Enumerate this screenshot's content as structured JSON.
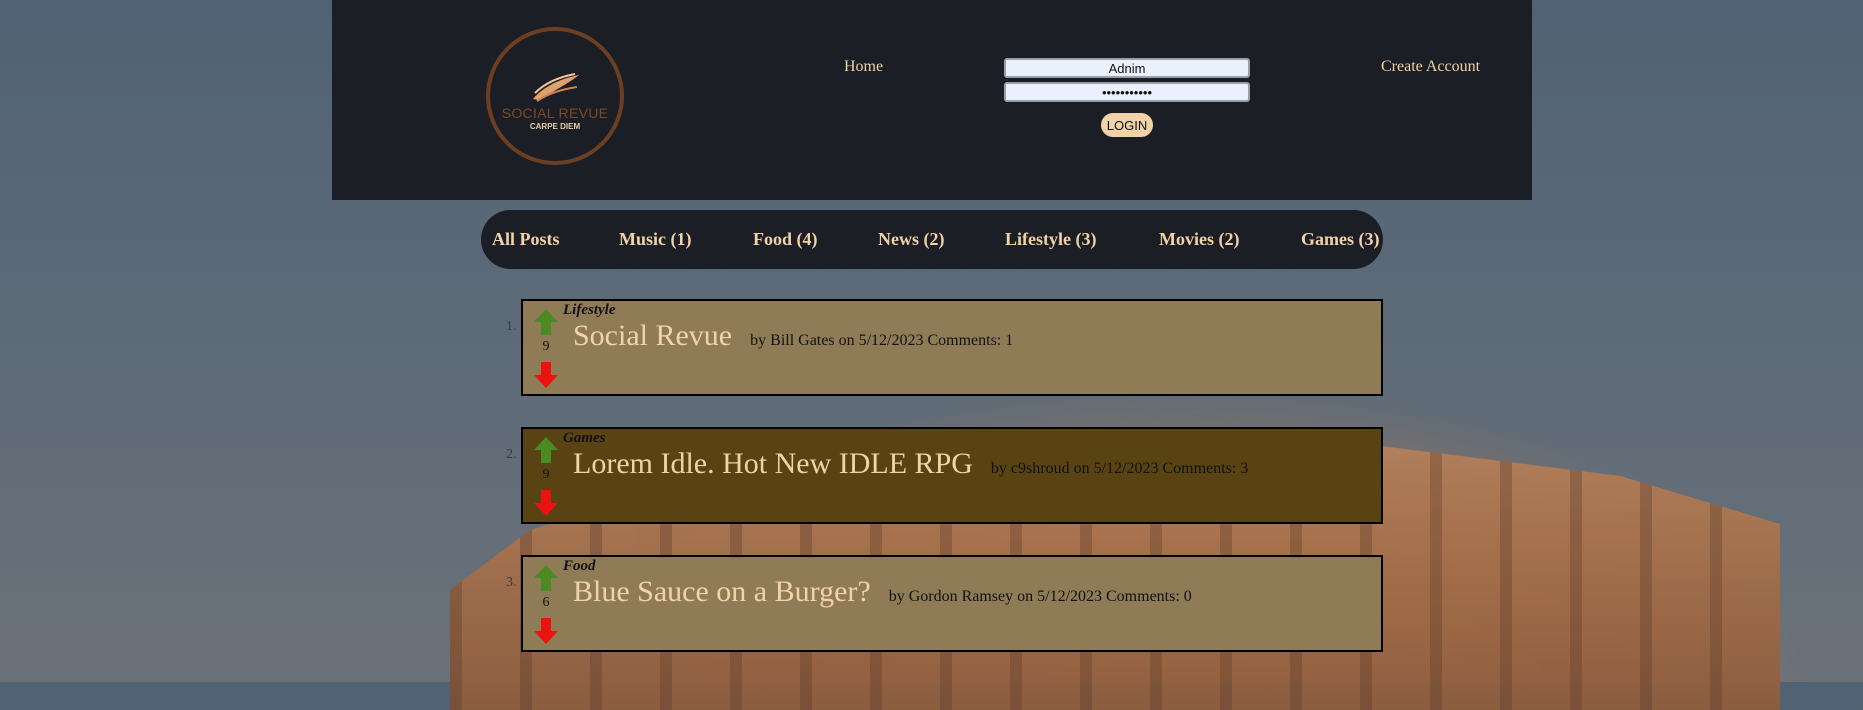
{
  "header": {
    "logo": {
      "name": "SOCIAL REVUE",
      "tagline": "CARPE DIEM"
    },
    "nav": {
      "home": "Home",
      "create_account": "Create Account"
    },
    "login": {
      "username_value": "Adnim",
      "password_value": "•••••••••••",
      "button": "LOGIN"
    }
  },
  "categories": [
    {
      "label": "All Posts"
    },
    {
      "label": "Music (1)"
    },
    {
      "label": "Food (4)"
    },
    {
      "label": "News (2)"
    },
    {
      "label": "Lifestyle (3)"
    },
    {
      "label": "Movies (2)"
    },
    {
      "label": "Games (3)"
    }
  ],
  "posts": [
    {
      "rank": "1.",
      "score": "9",
      "category": "Lifestyle",
      "title": "Social Revue",
      "meta": "by Bill Gates on 5/12/2023 Comments: 1"
    },
    {
      "rank": "2.",
      "score": "9",
      "category": "Games",
      "title": "Lorem Idle. Hot New IDLE RPG",
      "meta": "by c9shroud on 5/12/2023 Comments: 3"
    },
    {
      "rank": "3.",
      "score": "6",
      "category": "Food",
      "title": "Blue Sauce on a Burger?",
      "meta": "by Gordon Ramsey on 5/12/2023 Comments: 0"
    }
  ],
  "colors": {
    "header_bg": "#1b1e24",
    "accent": "#f2d2a7",
    "post_light": "#8f7c57",
    "post_dark": "#5a4313",
    "upvote": "#4c8a22",
    "downvote": "#ee1111"
  },
  "icons": {
    "upvote": "arrow-up-icon",
    "downvote": "arrow-down-icon",
    "logo": "wing-icon"
  }
}
